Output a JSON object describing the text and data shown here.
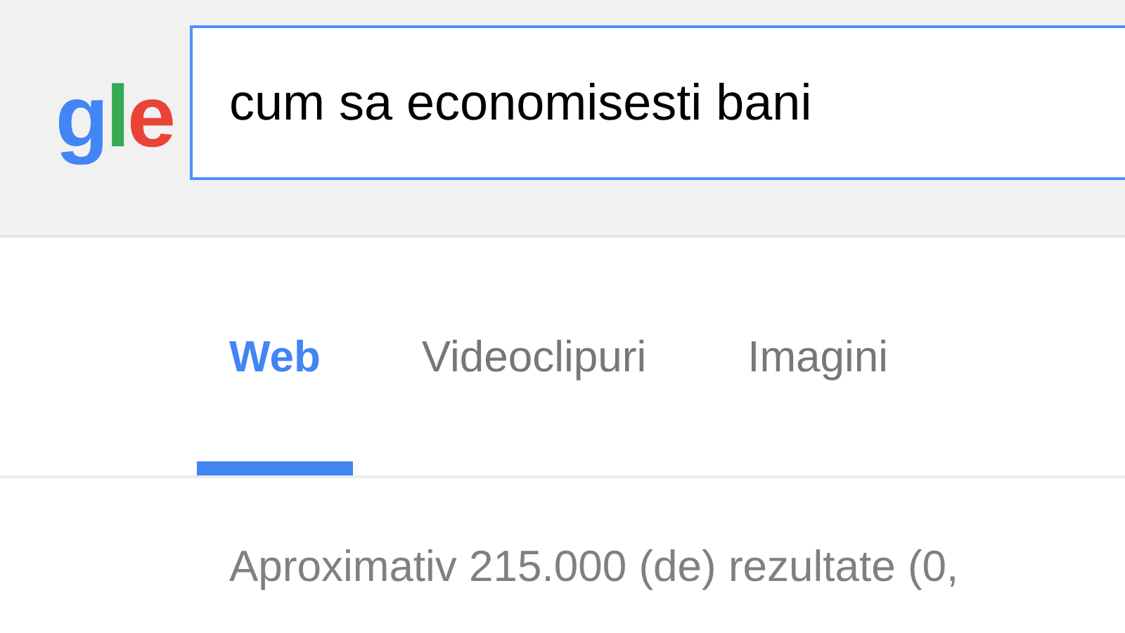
{
  "logo": "gle",
  "search": {
    "value": "cum sa economisesti bani"
  },
  "tabs": [
    {
      "label": "Web",
      "selected": true
    },
    {
      "label": "Videoclipuri",
      "selected": false
    },
    {
      "label": "Imagini",
      "selected": false
    }
  ],
  "result_stats": "Aproximativ 215.000 (de) rezultate (0,"
}
